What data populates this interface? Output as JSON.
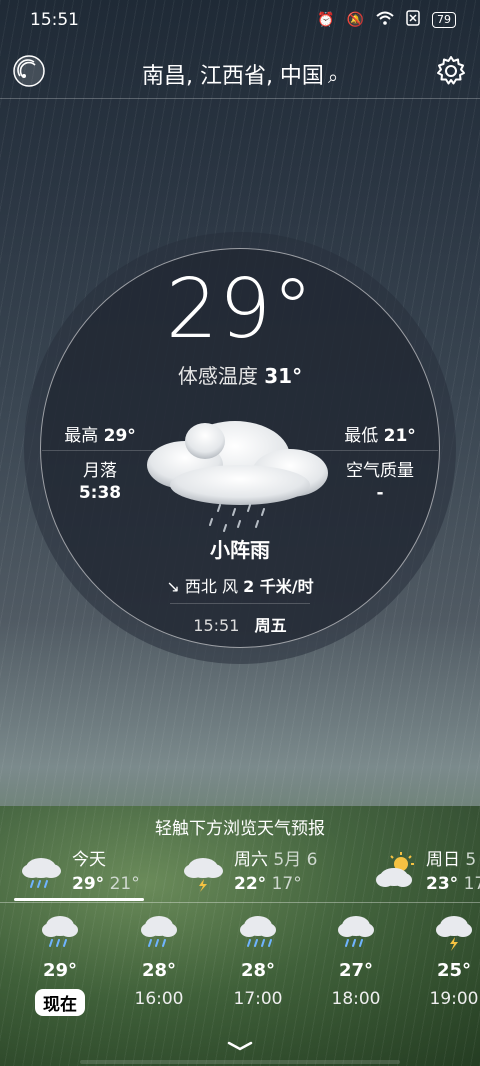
{
  "status": {
    "time": "15:51",
    "battery": "79"
  },
  "header": {
    "location": "南昌, 江西省, 中国"
  },
  "current": {
    "temp": "29°",
    "feels_label": "体感温度",
    "feels_value": "31°",
    "high_label": "最高",
    "high_value": "29°",
    "low_label": "最低",
    "low_value": "21°",
    "moonset_label": "月落",
    "moonset_value": "5:38",
    "aqi_label": "空气质量",
    "aqi_value": "-",
    "condition": "小阵雨",
    "wind_arrow": "↘",
    "wind_text": "西北 风",
    "wind_speed": "2 千米/时",
    "time": "15:51",
    "weekday": "周五"
  },
  "hint": "轻触下方浏览天气预报",
  "daily": [
    {
      "name": "今天",
      "date": "",
      "high": "29°",
      "low": "21°",
      "icon": "rain-cloud-icon"
    },
    {
      "name": "周六",
      "date": "5月 6",
      "high": "22°",
      "low": "17°",
      "icon": "thunder-cloud-icon"
    },
    {
      "name": "周日",
      "date": "5",
      "high": "23°",
      "low": "17",
      "icon": "partly-sunny-icon"
    }
  ],
  "hourly": [
    {
      "temp": "29°",
      "time": "现在",
      "icon": "rain-cloud-icon"
    },
    {
      "temp": "28°",
      "time": "16:00",
      "icon": "rain-cloud-icon"
    },
    {
      "temp": "28°",
      "time": "17:00",
      "icon": "rain-cloud-icon"
    },
    {
      "temp": "27°",
      "time": "18:00",
      "icon": "rain-cloud-icon"
    },
    {
      "temp": "25°",
      "time": "19:00",
      "icon": "thunder-cloud-icon"
    }
  ],
  "colors": {
    "rain_drop": "#6fb4ff",
    "sun": "#f5c242",
    "thunder": "#f5c242"
  }
}
